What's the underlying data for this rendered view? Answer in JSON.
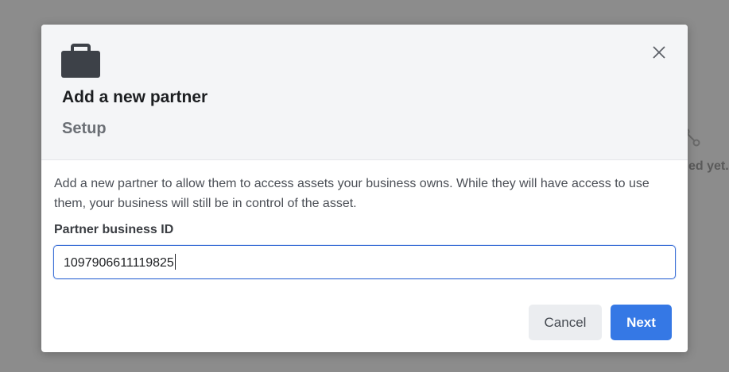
{
  "background": {
    "partial_text": "ed yet.",
    "icon": "share-nodes-icon"
  },
  "dialog": {
    "icon": "briefcase-icon",
    "close_icon": "close-icon",
    "title": "Add a new partner",
    "subtitle": "Setup",
    "description": "Add a new partner to allow them to access assets your business owns. While they will have access to use them, your business will still be in control of the asset.",
    "field": {
      "label": "Partner business ID",
      "value": "1097906611119825"
    },
    "buttons": {
      "cancel": "Cancel",
      "next": "Next"
    }
  },
  "colors": {
    "primary": "#3578e5",
    "header_bg": "#f4f5f7",
    "overlay": "#8c8c8c"
  }
}
